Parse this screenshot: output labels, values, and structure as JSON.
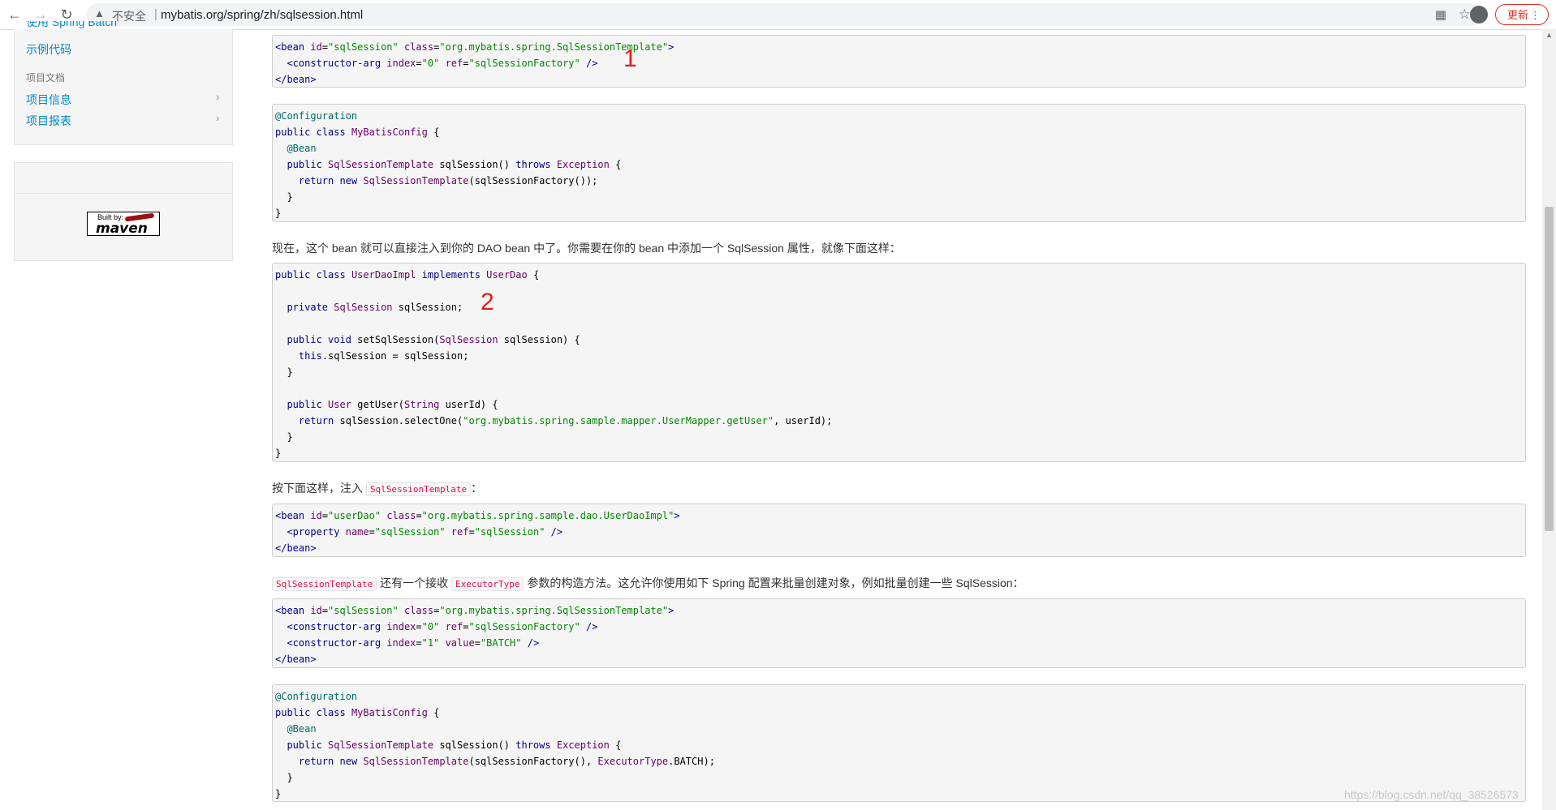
{
  "browser": {
    "back_icon": "←",
    "forward_icon": "→",
    "reload_icon": "↻",
    "insecure_label": "不安全",
    "separator": "|",
    "url": "mybatis.org/spring/zh/sqlsession.html",
    "update_label": "更新",
    "menu_icon": "⋮"
  },
  "sidebar": {
    "partial_link": "使用 Spring Batch",
    "link_examples": "示例代码",
    "header_project_docs": "项目文档",
    "link_project_info": "项目信息",
    "link_project_reports": "项目报表",
    "maven_badge_built": "Built by:",
    "maven_badge_word": "maven"
  },
  "content": {
    "para1": "现在，这个 bean 就可以直接注入到你的 DAO bean 中了。你需要在你的 bean 中添加一个 SqlSession 属性，就像下面这样：",
    "para2_prefix": "按下面这样，注入",
    "para2_code": "SqlSessionTemplate",
    "para2_suffix": "：",
    "para3_code1": "SqlSessionTemplate",
    "para3_mid": "还有一个接收",
    "para3_code2": "ExecutorType",
    "para3_suffix": "参数的构造方法。这允许你使用如下 Spring 配置来批量创建对象，例如批量创建一些 SqlSession：",
    "marker1": "1",
    "marker2": "2"
  },
  "watermark": "https://blog.csdn.net/qq_38526573"
}
